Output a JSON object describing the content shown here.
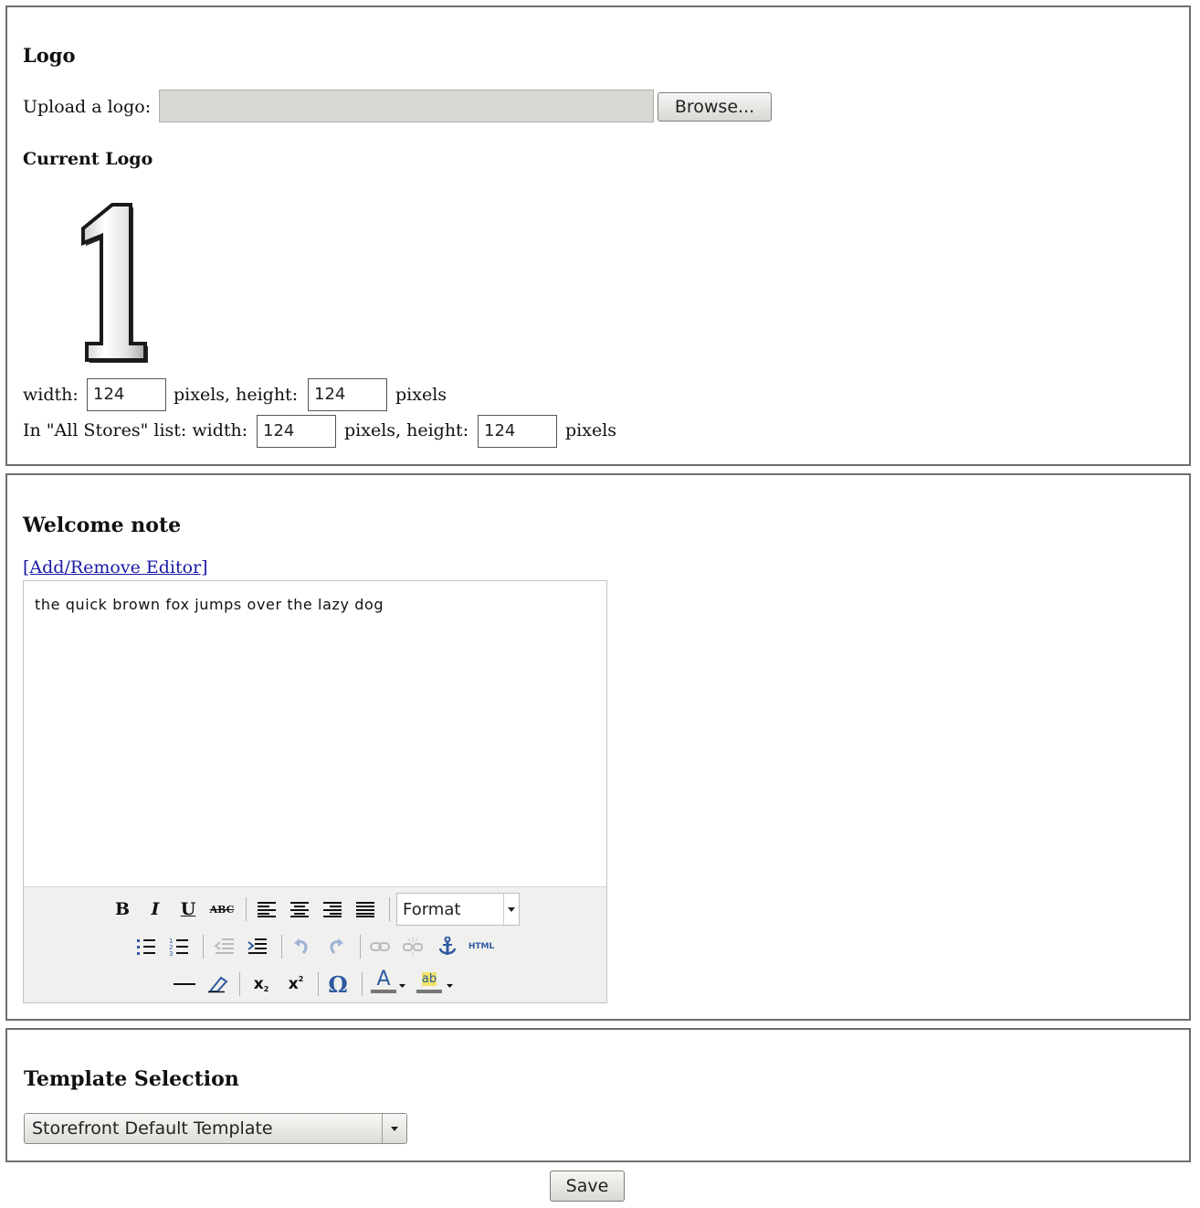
{
  "logo_section": {
    "heading": "Logo",
    "upload_label": "Upload a logo:",
    "browse_label": "Browse...",
    "current_logo_heading": "Current Logo",
    "logo_glyph": "1",
    "size_row": {
      "width_label": "width:",
      "width_value": "124",
      "mid_label": "pixels, height:",
      "height_value": "124",
      "end_label": "pixels"
    },
    "list_row": {
      "width_label": "In \"All Stores\" list: width:",
      "width_value": "124",
      "mid_label": "pixels, height:",
      "height_value": "124",
      "end_label": "pixels"
    }
  },
  "welcome_section": {
    "heading": "Welcome note",
    "toggle_link": "[Add/Remove Editor]",
    "editor_text": "the quick brown fox jumps over the lazy dog",
    "toolbar": {
      "bold": "B",
      "italic": "I",
      "underline": "U",
      "strike": "ABC",
      "format_label": "Format",
      "html_label": "HTML",
      "subscript": "x",
      "superscript": "x",
      "omega": "Ω",
      "text_color": "A",
      "highlight": "ab"
    }
  },
  "template_section": {
    "heading": "Template Selection",
    "selected_template": "Storefront Default Template"
  },
  "save_label": "Save",
  "colors": {
    "border": "#6e6e6e",
    "link": "#1a1aa6",
    "toolbar_bg": "#f0f0ee",
    "icon_blue": "#2c5aa0"
  }
}
